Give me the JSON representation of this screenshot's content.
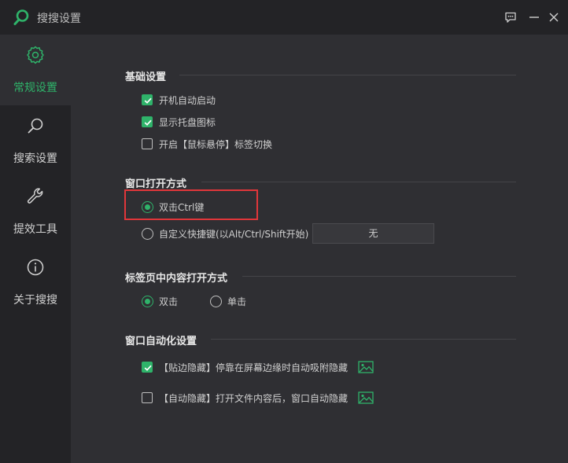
{
  "app": {
    "title": "搜搜设置"
  },
  "colors": {
    "accent": "#2fb36a",
    "highlight_border": "#e0363a",
    "background": "#2f2f33",
    "sidebar": "#232326"
  },
  "titlebar_icons": [
    "feedback-icon",
    "minimize-icon",
    "close-icon"
  ],
  "sidebar": {
    "items": [
      {
        "label": "常规设置",
        "icon": "gear-icon",
        "active": true
      },
      {
        "label": "搜索设置",
        "icon": "search-icon",
        "active": false
      },
      {
        "label": "提效工具",
        "icon": "wrench-icon",
        "active": false
      },
      {
        "label": "关于搜搜",
        "icon": "info-icon",
        "active": false
      }
    ]
  },
  "basic": {
    "title": "基础设置",
    "options": [
      {
        "label": "开机自动启动",
        "checked": true
      },
      {
        "label": "显示托盘图标",
        "checked": true
      },
      {
        "label": "开启【鼠标悬停】标签切换",
        "checked": false
      }
    ]
  },
  "window_open": {
    "title": "窗口打开方式",
    "options": [
      {
        "label": "双击Ctrl键",
        "selected": true
      },
      {
        "label": "自定义快捷键(以Alt/Ctrl/Shift开始)",
        "selected": false
      }
    ],
    "shortcut_value": "无"
  },
  "tab_open": {
    "title": "标签页中内容打开方式",
    "options": [
      {
        "label": "双击",
        "selected": true
      },
      {
        "label": "单击",
        "selected": false
      }
    ]
  },
  "auto": {
    "title": "窗口自动化设置",
    "options": [
      {
        "label": "【贴边隐藏】停靠在屏幕边缘时自动吸附隐藏",
        "checked": true,
        "icon": "image-preview-icon"
      },
      {
        "label": "【自动隐藏】打开文件内容后，窗口自动隐藏",
        "checked": false,
        "icon": "image-preview-icon"
      }
    ]
  }
}
